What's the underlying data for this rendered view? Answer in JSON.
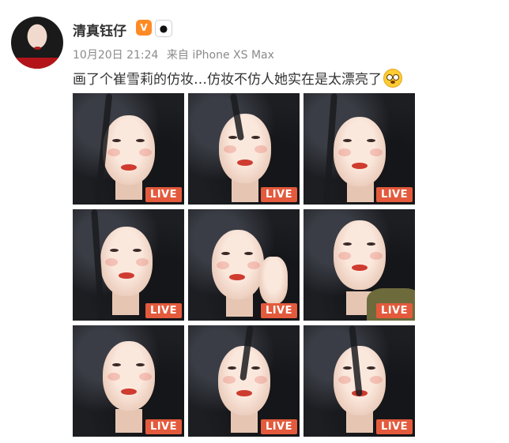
{
  "post": {
    "username": "清真钰仔",
    "badges": [
      "vip-badge-icon",
      "panda-icon"
    ],
    "date": "10月20日 21:24",
    "source": "来自 iPhone XS Max",
    "text": "画了个崔雪莉的仿妆…仿妆不仿人她实在是太漂亮了",
    "emoji": "astonished-face-emoji"
  },
  "photos": [
    {
      "badge": "LIVE"
    },
    {
      "badge": "LIVE"
    },
    {
      "badge": "LIVE"
    },
    {
      "badge": "LIVE"
    },
    {
      "badge": "LIVE"
    },
    {
      "badge": "LIVE"
    },
    {
      "badge": "LIVE"
    },
    {
      "badge": "LIVE"
    },
    {
      "badge": "LIVE"
    }
  ],
  "colors": {
    "live_badge": "#e35a3c",
    "text": "#333333",
    "meta": "#8a8a8a"
  }
}
